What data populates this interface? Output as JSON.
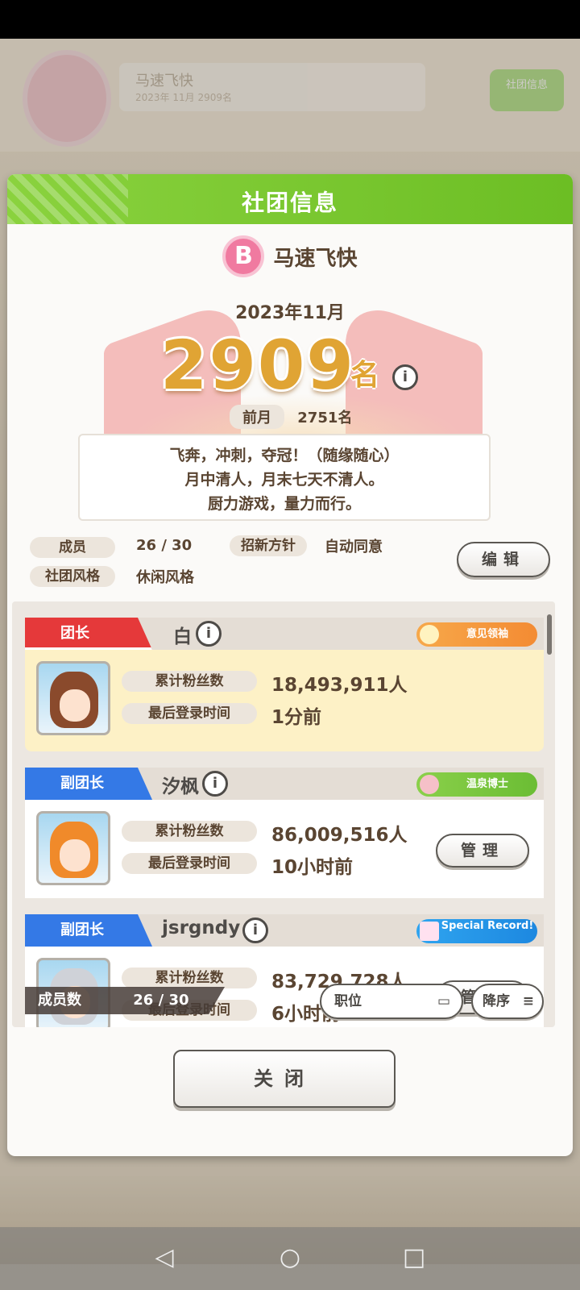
{
  "background": {
    "club_name": "马速飞快",
    "club_sub": "2023年 11月 2909名",
    "green_button": "社团信息"
  },
  "dialog": {
    "title": "社团信息",
    "club_name": "马速飞快",
    "club_rank_badge": "B",
    "month": "2023年11月",
    "rank": "2909",
    "rank_unit": "名",
    "prev_label": "前月",
    "prev_value": "2751名",
    "motto": [
      "飞奔，冲刺，夺冠！（随缘随心）",
      "月中清人，月末七天不清人。",
      "厨力游戏，量力而行。"
    ],
    "stats": {
      "members_label": "成员",
      "members_value": "26 / 30",
      "recruit_label": "招新方针",
      "recruit_value": "自动同意",
      "style_label": "社团风格",
      "style_value": "休闲风格",
      "edit_label": "编辑"
    },
    "members": [
      {
        "role": "团长",
        "name": "白",
        "badge": "意见领袖",
        "fans_label": "累计粉丝数",
        "fans": "18,493,911人",
        "login_label": "最后登录时间",
        "login": "1分前"
      },
      {
        "role": "副团长",
        "name": "汐枫",
        "badge": "温泉博士",
        "fans_label": "累计粉丝数",
        "fans": "86,009,516人",
        "login_label": "最后登录时间",
        "login": "10小时前",
        "manage_label": "管理"
      },
      {
        "role": "副团长",
        "name": "jsrgndy",
        "badge": "Special Record!",
        "fans_label": "累计粉丝数",
        "fans": "83,729,728人",
        "login_label": "最后登录时间",
        "login": "6小时前",
        "manage_label": "管理"
      }
    ],
    "member_count_label": "成员数",
    "member_count_value": "26 / 30",
    "sort_field": "职位",
    "sort_order": "降序",
    "close_label": "关闭"
  },
  "colors": {
    "header_green": "#7cc92f",
    "leader_red": "#e5393a",
    "vice_blue": "#3479e6",
    "rank_gold": "#e0a434"
  }
}
